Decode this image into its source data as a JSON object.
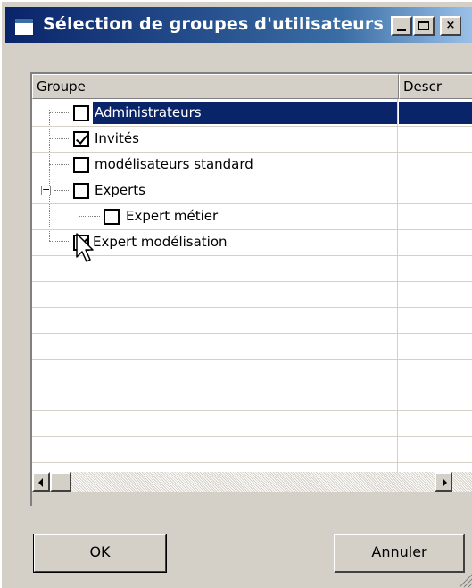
{
  "window": {
    "title": "Sélection de groupes d'utilisateurs",
    "controls": [
      "minimize-icon",
      "maximize-icon",
      "close-icon"
    ],
    "close_glyph": "×"
  },
  "list": {
    "columns": [
      "Groupe",
      "Descr"
    ],
    "rows": [
      {
        "label": "Administrateurs",
        "checked": false,
        "selected": true
      },
      {
        "label": "Invités",
        "checked": true,
        "selected": false
      },
      {
        "label": "modélisateurs standard",
        "checked": false,
        "selected": false
      },
      {
        "label": "Experts",
        "checked": false,
        "selected": false,
        "expanded": true
      },
      {
        "label": "Expert métier",
        "checked": false,
        "selected": false,
        "child": true
      },
      {
        "label": "Expert modélisation",
        "checked": true,
        "selected": false
      }
    ]
  },
  "buttons": {
    "ok": "OK",
    "cancel": "Annuler"
  },
  "colors": {
    "selection": "#0a246a",
    "face": "#d4d0c8"
  }
}
